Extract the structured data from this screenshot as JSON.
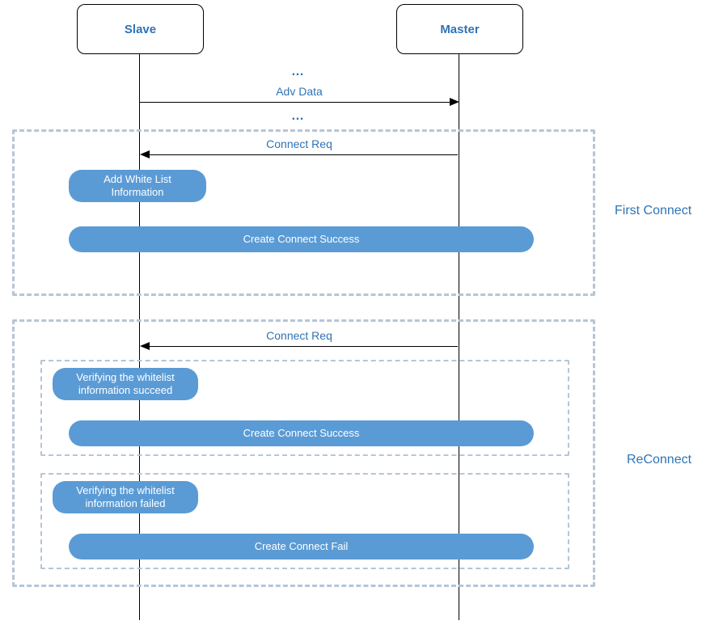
{
  "actors": {
    "slave": "Slave",
    "master": "Master"
  },
  "messages": {
    "adv_data": "Adv Data",
    "connect_req_1": "Connect Req",
    "connect_req_2": "Connect Req"
  },
  "ellipsis": {
    "top": "…",
    "mid": "…"
  },
  "pills": {
    "add_whitelist": "Add White List Information",
    "create_success_1": "Create Connect Success",
    "verify_succeed": "Verifying the whitelist information succeed",
    "create_success_2": "Create Connect Success",
    "verify_failed": "Verifying the whitelist information failed",
    "create_fail": "Create Connect Fail"
  },
  "groups": {
    "first_connect": "First Connect",
    "reconnect": "ReConnect"
  }
}
